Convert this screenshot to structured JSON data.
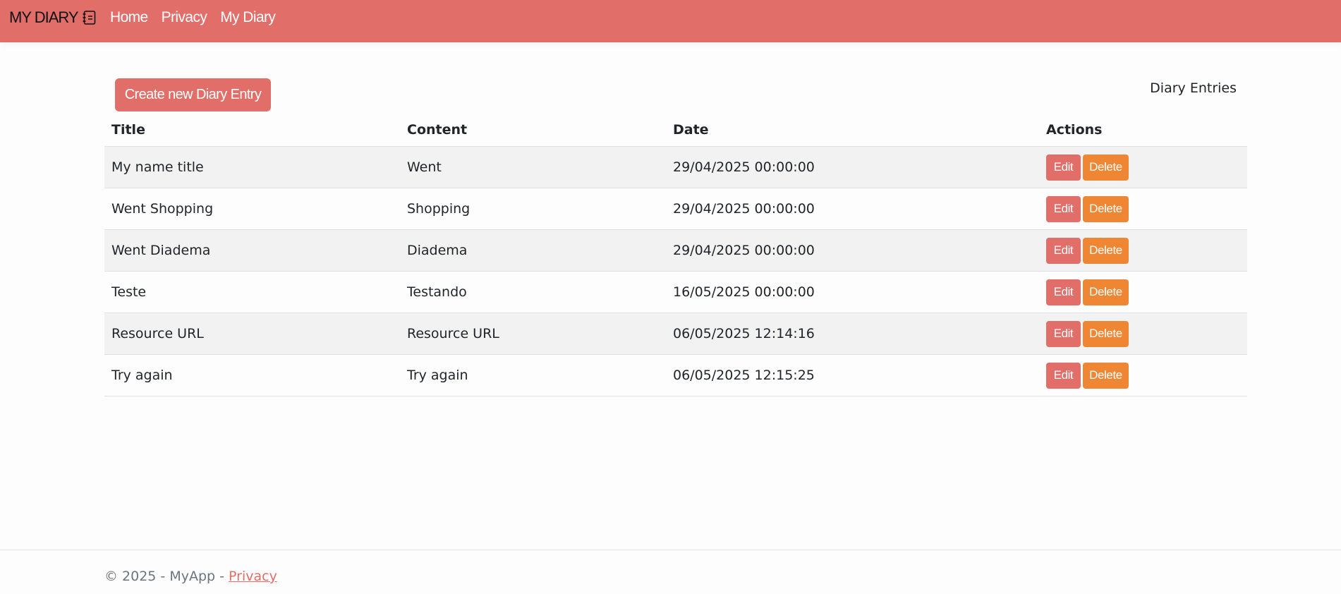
{
  "navbar": {
    "brand": "MY DIARY",
    "brand_icon": "journal-icon",
    "links": [
      {
        "label": "Home"
      },
      {
        "label": "Privacy"
      },
      {
        "label": "My Diary"
      }
    ],
    "background": "#e16e69"
  },
  "main": {
    "create_button_label": "Create new Diary Entry",
    "section_label": "Diary Entries",
    "table": {
      "headers": [
        "Title",
        "Content",
        "Date",
        "Actions"
      ],
      "rows": [
        {
          "title": "My name title",
          "content": "Went",
          "date": "29/04/2025 00:00:00"
        },
        {
          "title": "Went Shopping",
          "content": "Shopping",
          "date": "29/04/2025 00:00:00"
        },
        {
          "title": "Went Diadema",
          "content": "Diadema",
          "date": "29/04/2025 00:00:00"
        },
        {
          "title": "Teste",
          "content": "Testando",
          "date": "16/05/2025 00:00:00"
        },
        {
          "title": "Resource URL",
          "content": "Resource URL",
          "date": "06/05/2025 12:14:16"
        },
        {
          "title": "Try again",
          "content": "Try again",
          "date": "06/05/2025 12:15:25"
        }
      ],
      "edit_label": "Edit",
      "delete_label": "Delete"
    }
  },
  "footer": {
    "text": "© 2025 - MyApp - ",
    "link_label": "Privacy"
  },
  "colors": {
    "primary": "#e16e69",
    "warning": "#ef8633"
  }
}
